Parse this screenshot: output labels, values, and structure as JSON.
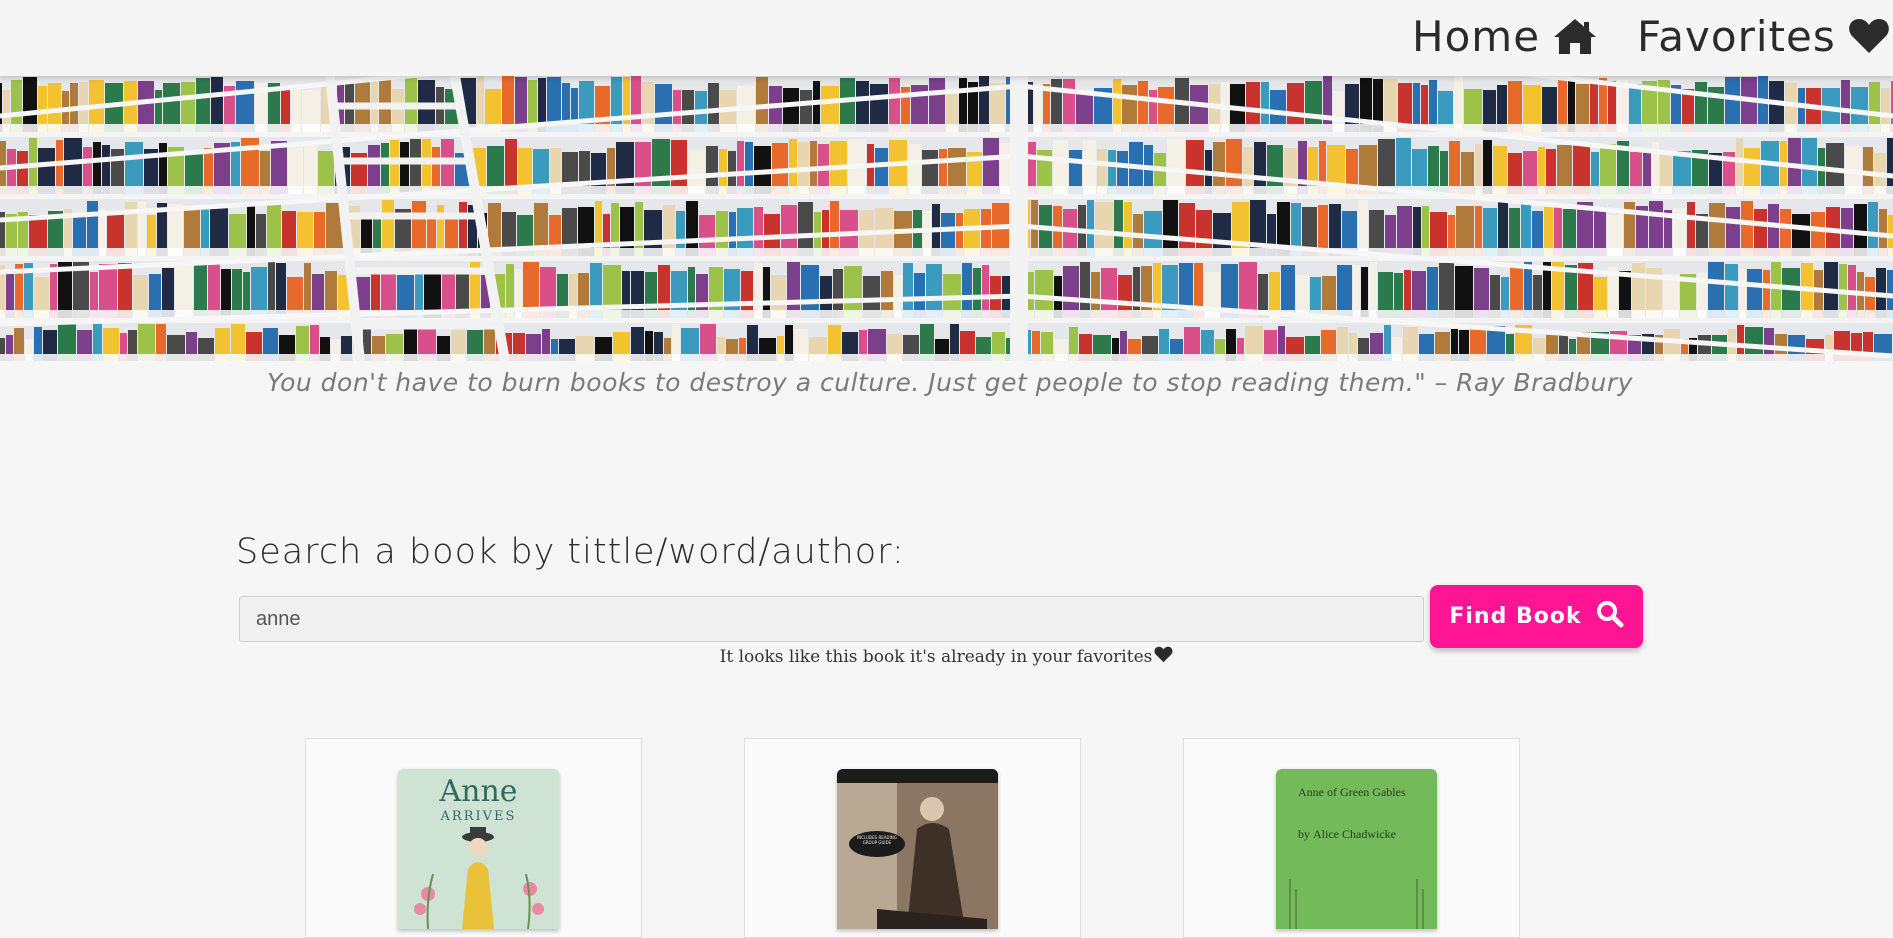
{
  "nav": {
    "home_label": "Home",
    "favorites_label": "Favorites"
  },
  "hero": {
    "quote": "You don't have to burn books to destroy a culture. Just get people to stop reading them.\" – Ray Bradbury"
  },
  "search": {
    "label": "Search a book by tittle/word/author:",
    "value": "anne",
    "button_label": "Find Book",
    "notice": "It looks like this book it's already in your favorites"
  },
  "books": [
    {
      "cover_title": "Anne",
      "cover_subtitle": "ARRIVES"
    },
    {
      "cover_badge": "INCLUDES READING GROUP GUIDE"
    },
    {
      "cover_title": "Anne of Green Gables",
      "cover_author_prefix": "by",
      "cover_author": "Alice Chadwicke"
    }
  ],
  "colors": {
    "accent": "#ff1493",
    "nav_bg": "#f5f5f5",
    "page_bg": "#f6f6f6",
    "text": "#2b2b2b"
  },
  "icons": {
    "home": "home-icon",
    "favorites": "heart-icon",
    "search": "search-icon"
  }
}
